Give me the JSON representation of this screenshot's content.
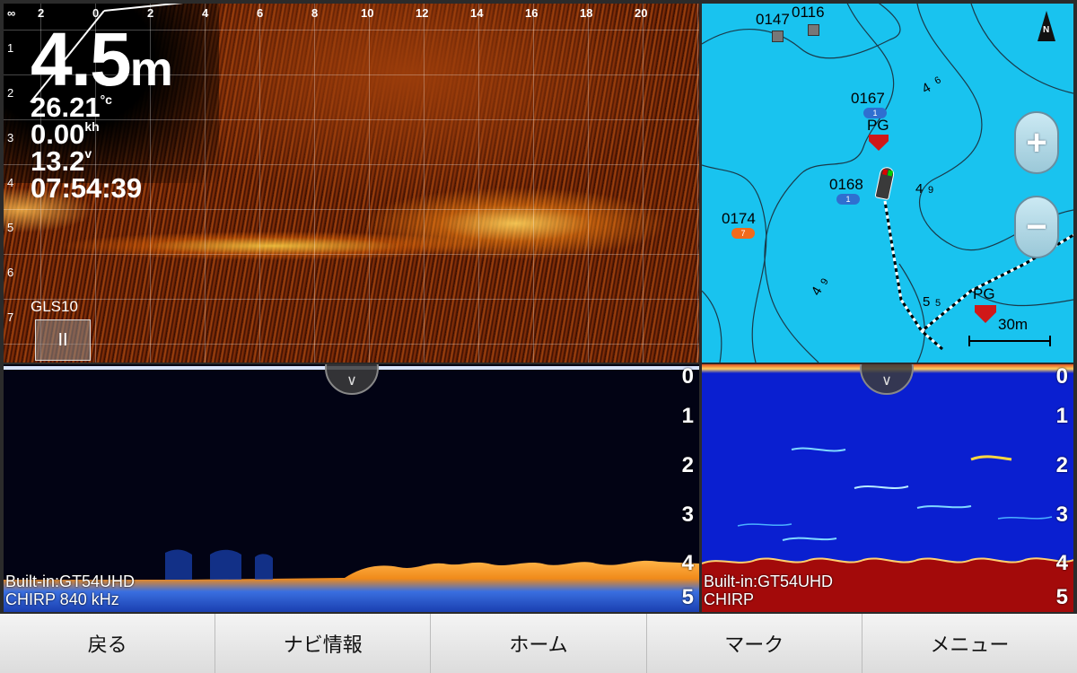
{
  "livescope": {
    "depth_value": "4.5",
    "depth_unit": "m",
    "temperature": "26.21",
    "temperature_unit": "°c",
    "speed": "0.00",
    "speed_unit": "kh",
    "voltage": "13.2",
    "voltage_unit": "v",
    "time": "07:54:39",
    "transducer": "GLS10",
    "pause_label": "II",
    "top_scale": [
      "∞",
      "2",
      "0",
      "2",
      "4",
      "6",
      "8",
      "10",
      "12",
      "14",
      "16",
      "18",
      "20"
    ],
    "left_scale": [
      "1",
      "2",
      "3",
      "4",
      "5",
      "6",
      "7"
    ]
  },
  "chart": {
    "waypoints": [
      {
        "id": "0147"
      },
      {
        "id": "0116"
      },
      {
        "id": "0167"
      },
      {
        "id": "0168"
      },
      {
        "id": "0174"
      }
    ],
    "pg_labels": [
      "PG",
      "PG"
    ],
    "contours": [
      "4",
      "6",
      "4",
      "9",
      "4",
      "9",
      "5",
      "5"
    ],
    "scale_label": "30m",
    "north_label": "N",
    "zoom_in": "+",
    "zoom_out": "−",
    "fish_counts": [
      "1",
      "1",
      "7"
    ]
  },
  "sonar_traditional": {
    "source": "Built-in:GT54UHD",
    "mode": "CHIRP 840 kHz",
    "depth_scale": [
      "0",
      "1",
      "2",
      "3",
      "4",
      "5"
    ]
  },
  "sonar_chirp": {
    "source": "Built-in:GT54UHD",
    "mode": "CHIRP",
    "depth_scale": [
      "0",
      "1",
      "2",
      "3",
      "4",
      "5"
    ]
  },
  "navbar": {
    "back": "戻る",
    "navi_info": "ナビ情報",
    "home": "ホーム",
    "mark": "マーク",
    "menu": "メニュー"
  },
  "colors": {
    "chart_water": "#19c3ef",
    "chirp_background": "#0a1fd0",
    "chirp_bottom": "#a30a0a",
    "trad_background": "#020314",
    "livescope_base": "#2a0800"
  }
}
